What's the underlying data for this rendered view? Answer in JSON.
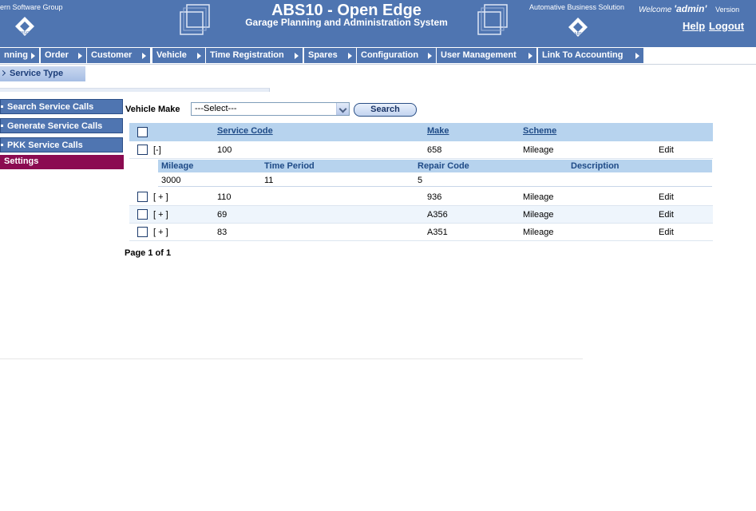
{
  "header": {
    "company": "ern Software Group",
    "title": "ABS10 - Open Edge",
    "subtitle": "Garage Planning and Administration System",
    "abs_caption": "Automative Business Solution",
    "welcome_prefix": "Welcome",
    "welcome_user": "'admin'",
    "version_label": "Version",
    "help_label": "Help",
    "logout_label": "Logout"
  },
  "menu": {
    "items": [
      {
        "label": "nning"
      },
      {
        "label": "Order"
      },
      {
        "label": "Customer"
      },
      {
        "label": "Vehicle"
      },
      {
        "label": "Time Registration"
      },
      {
        "label": "Spares"
      },
      {
        "label": "Configuration"
      },
      {
        "label": "User Management"
      },
      {
        "label": "Link To Accounting"
      }
    ]
  },
  "page_tab": {
    "label": "Service Type"
  },
  "sidebar": {
    "items": [
      {
        "label": "Search Service Calls"
      },
      {
        "label": "Generate Service Calls"
      },
      {
        "label": "PKK Service Calls"
      }
    ],
    "settings_label": "Settings"
  },
  "search": {
    "label": "Vehicle Make",
    "selected": "---Select---",
    "button_label": "Search"
  },
  "grid": {
    "columns": {
      "service_code": "Service Code",
      "make": "Make",
      "scheme": "Scheme"
    },
    "rows": [
      {
        "toggle": "[-]",
        "service_code": "100",
        "make": "658",
        "scheme": "Mileage",
        "edit": "Edit"
      },
      {
        "toggle": "[ + ]",
        "service_code": "110",
        "make": "936",
        "scheme": "Mileage",
        "edit": "Edit"
      },
      {
        "toggle": "[ + ]",
        "service_code": "69",
        "make": "A356",
        "scheme": "Mileage",
        "edit": "Edit"
      },
      {
        "toggle": "[ + ]",
        "service_code": "83",
        "make": "A351",
        "scheme": "Mileage",
        "edit": "Edit"
      }
    ],
    "detail": {
      "columns": {
        "mileage": "Mileage",
        "time_period": "Time Period",
        "repair_code": "Repair Code",
        "description": "Description"
      },
      "row": {
        "mileage": "3000",
        "time_period": "11",
        "repair_code": "5",
        "description": ""
      }
    }
  },
  "pager": {
    "text": "Page 1 of 1"
  },
  "colors": {
    "header_blue": "#4f75b1",
    "grid_header": "#b7d3ee",
    "settings_bg": "#8b0b51"
  }
}
